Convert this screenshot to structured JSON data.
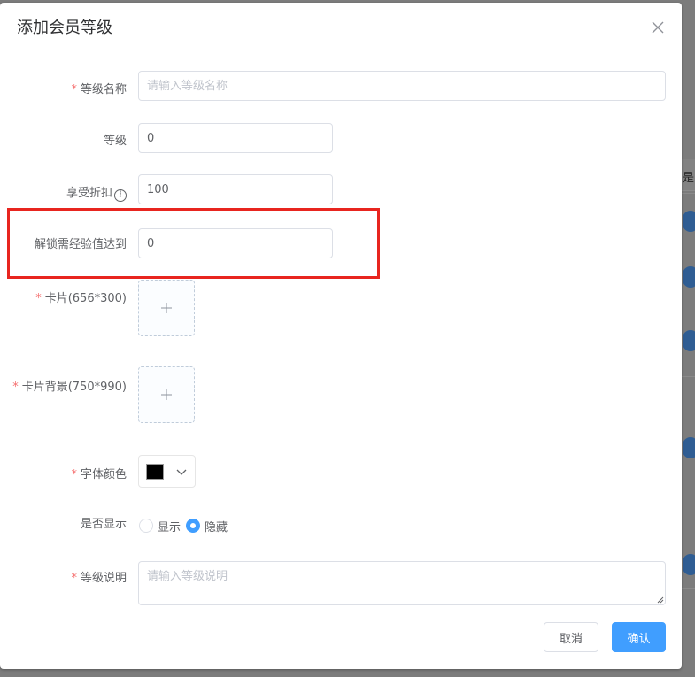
{
  "background": {
    "column_header": "是",
    "accent": "#2f5d93"
  },
  "dialog": {
    "title": "添加会员等级"
  },
  "form": {
    "required_mark": "*",
    "level_name": {
      "label": "等级名称",
      "placeholder": "请输入等级名称",
      "value": ""
    },
    "level": {
      "label": "等级",
      "value": "0"
    },
    "discount": {
      "label": "享受折扣",
      "value": "100",
      "icon": "info-icon"
    },
    "unlock_exp": {
      "label": "解锁需经验值达到",
      "value": "0"
    },
    "card": {
      "label": "卡片(656*300)",
      "icon": "plus-icon"
    },
    "card_bg": {
      "label": "卡片背景(750*990)",
      "icon": "plus-icon"
    },
    "font_color": {
      "label": "字体颜色",
      "value": "#000000",
      "icon": "chevron-down-icon"
    },
    "visible": {
      "label": "是否显示",
      "options": [
        {
          "label": "显示",
          "checked": false
        },
        {
          "label": "隐藏",
          "checked": true
        }
      ]
    },
    "description": {
      "label": "等级说明",
      "placeholder": "请输入等级说明",
      "value": ""
    }
  },
  "footer": {
    "cancel_label": "取消",
    "confirm_label": "确认"
  },
  "colors": {
    "primary": "#409eff",
    "required": "#f56c6c",
    "highlight": "#e8251f"
  }
}
